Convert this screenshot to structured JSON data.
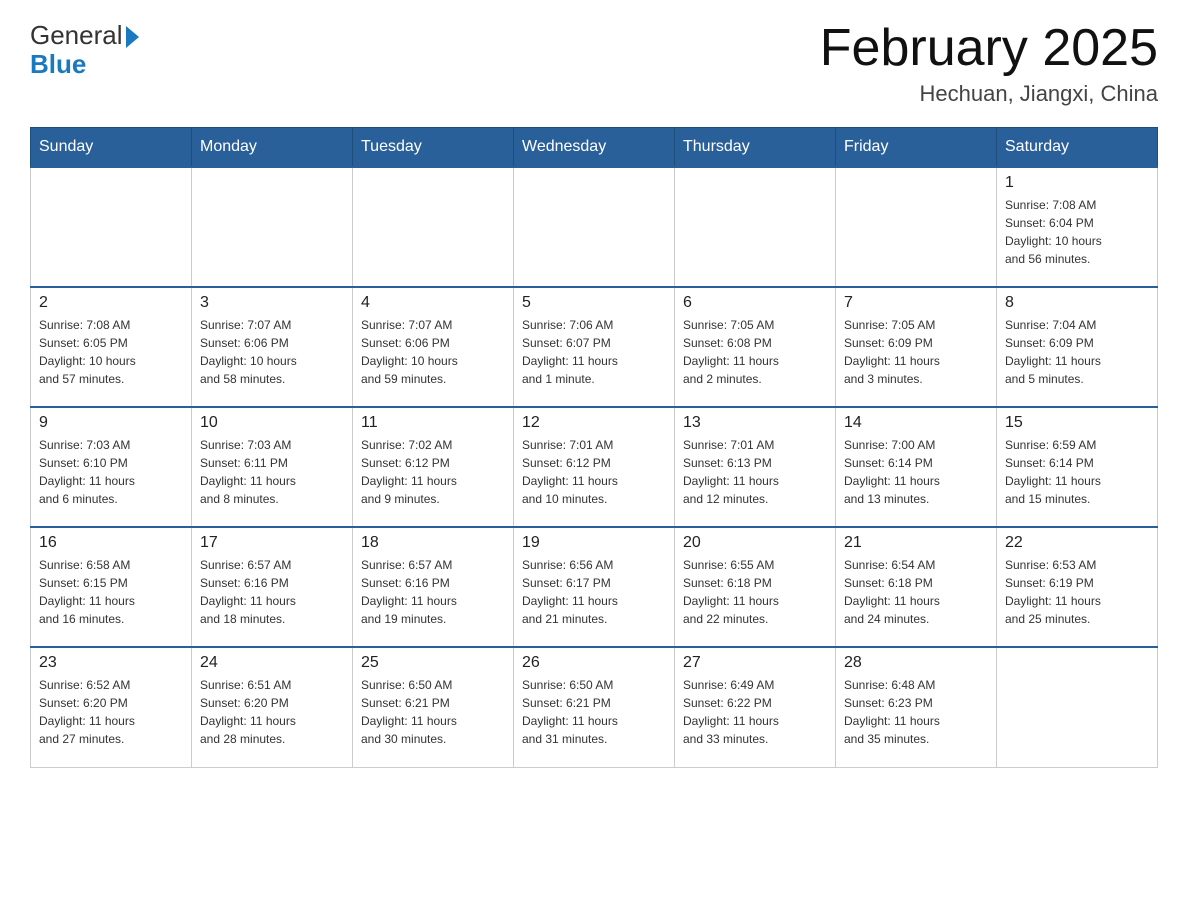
{
  "header": {
    "title": "February 2025",
    "subtitle": "Hechuan, Jiangxi, China",
    "logo_general": "General",
    "logo_blue": "Blue"
  },
  "days_of_week": [
    "Sunday",
    "Monday",
    "Tuesday",
    "Wednesday",
    "Thursday",
    "Friday",
    "Saturday"
  ],
  "weeks": [
    {
      "days": [
        {
          "number": "",
          "info": ""
        },
        {
          "number": "",
          "info": ""
        },
        {
          "number": "",
          "info": ""
        },
        {
          "number": "",
          "info": ""
        },
        {
          "number": "",
          "info": ""
        },
        {
          "number": "",
          "info": ""
        },
        {
          "number": "1",
          "info": "Sunrise: 7:08 AM\nSunset: 6:04 PM\nDaylight: 10 hours\nand 56 minutes."
        }
      ]
    },
    {
      "days": [
        {
          "number": "2",
          "info": "Sunrise: 7:08 AM\nSunset: 6:05 PM\nDaylight: 10 hours\nand 57 minutes."
        },
        {
          "number": "3",
          "info": "Sunrise: 7:07 AM\nSunset: 6:06 PM\nDaylight: 10 hours\nand 58 minutes."
        },
        {
          "number": "4",
          "info": "Sunrise: 7:07 AM\nSunset: 6:06 PM\nDaylight: 10 hours\nand 59 minutes."
        },
        {
          "number": "5",
          "info": "Sunrise: 7:06 AM\nSunset: 6:07 PM\nDaylight: 11 hours\nand 1 minute."
        },
        {
          "number": "6",
          "info": "Sunrise: 7:05 AM\nSunset: 6:08 PM\nDaylight: 11 hours\nand 2 minutes."
        },
        {
          "number": "7",
          "info": "Sunrise: 7:05 AM\nSunset: 6:09 PM\nDaylight: 11 hours\nand 3 minutes."
        },
        {
          "number": "8",
          "info": "Sunrise: 7:04 AM\nSunset: 6:09 PM\nDaylight: 11 hours\nand 5 minutes."
        }
      ]
    },
    {
      "days": [
        {
          "number": "9",
          "info": "Sunrise: 7:03 AM\nSunset: 6:10 PM\nDaylight: 11 hours\nand 6 minutes."
        },
        {
          "number": "10",
          "info": "Sunrise: 7:03 AM\nSunset: 6:11 PM\nDaylight: 11 hours\nand 8 minutes."
        },
        {
          "number": "11",
          "info": "Sunrise: 7:02 AM\nSunset: 6:12 PM\nDaylight: 11 hours\nand 9 minutes."
        },
        {
          "number": "12",
          "info": "Sunrise: 7:01 AM\nSunset: 6:12 PM\nDaylight: 11 hours\nand 10 minutes."
        },
        {
          "number": "13",
          "info": "Sunrise: 7:01 AM\nSunset: 6:13 PM\nDaylight: 11 hours\nand 12 minutes."
        },
        {
          "number": "14",
          "info": "Sunrise: 7:00 AM\nSunset: 6:14 PM\nDaylight: 11 hours\nand 13 minutes."
        },
        {
          "number": "15",
          "info": "Sunrise: 6:59 AM\nSunset: 6:14 PM\nDaylight: 11 hours\nand 15 minutes."
        }
      ]
    },
    {
      "days": [
        {
          "number": "16",
          "info": "Sunrise: 6:58 AM\nSunset: 6:15 PM\nDaylight: 11 hours\nand 16 minutes."
        },
        {
          "number": "17",
          "info": "Sunrise: 6:57 AM\nSunset: 6:16 PM\nDaylight: 11 hours\nand 18 minutes."
        },
        {
          "number": "18",
          "info": "Sunrise: 6:57 AM\nSunset: 6:16 PM\nDaylight: 11 hours\nand 19 minutes."
        },
        {
          "number": "19",
          "info": "Sunrise: 6:56 AM\nSunset: 6:17 PM\nDaylight: 11 hours\nand 21 minutes."
        },
        {
          "number": "20",
          "info": "Sunrise: 6:55 AM\nSunset: 6:18 PM\nDaylight: 11 hours\nand 22 minutes."
        },
        {
          "number": "21",
          "info": "Sunrise: 6:54 AM\nSunset: 6:18 PM\nDaylight: 11 hours\nand 24 minutes."
        },
        {
          "number": "22",
          "info": "Sunrise: 6:53 AM\nSunset: 6:19 PM\nDaylight: 11 hours\nand 25 minutes."
        }
      ]
    },
    {
      "days": [
        {
          "number": "23",
          "info": "Sunrise: 6:52 AM\nSunset: 6:20 PM\nDaylight: 11 hours\nand 27 minutes."
        },
        {
          "number": "24",
          "info": "Sunrise: 6:51 AM\nSunset: 6:20 PM\nDaylight: 11 hours\nand 28 minutes."
        },
        {
          "number": "25",
          "info": "Sunrise: 6:50 AM\nSunset: 6:21 PM\nDaylight: 11 hours\nand 30 minutes."
        },
        {
          "number": "26",
          "info": "Sunrise: 6:50 AM\nSunset: 6:21 PM\nDaylight: 11 hours\nand 31 minutes."
        },
        {
          "number": "27",
          "info": "Sunrise: 6:49 AM\nSunset: 6:22 PM\nDaylight: 11 hours\nand 33 minutes."
        },
        {
          "number": "28",
          "info": "Sunrise: 6:48 AM\nSunset: 6:23 PM\nDaylight: 11 hours\nand 35 minutes."
        },
        {
          "number": "",
          "info": ""
        }
      ]
    }
  ]
}
